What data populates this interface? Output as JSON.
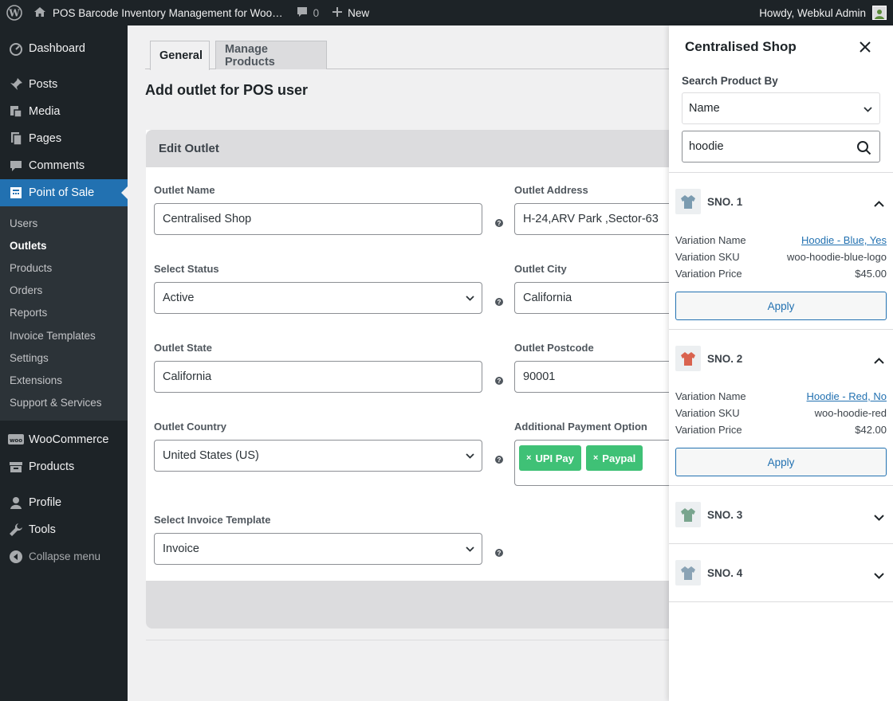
{
  "admin_bar": {
    "site_title": "POS Barcode Inventory Management for Woo…",
    "comment_count": "0",
    "new_label": "New",
    "greeting": "Howdy, Webkul Admin"
  },
  "sidebar": {
    "top_items": [
      {
        "label": "Dashboard"
      }
    ],
    "main_items": [
      {
        "label": "Posts"
      },
      {
        "label": "Media"
      },
      {
        "label": "Pages"
      },
      {
        "label": "Comments"
      },
      {
        "label": "Point of Sale"
      }
    ],
    "submenu": [
      {
        "label": "Users"
      },
      {
        "label": "Outlets"
      },
      {
        "label": "Products"
      },
      {
        "label": "Orders"
      },
      {
        "label": "Reports"
      },
      {
        "label": "Invoice Templates"
      },
      {
        "label": "Settings"
      },
      {
        "label": "Extensions"
      },
      {
        "label": "Support & Services"
      }
    ],
    "woo_items": [
      {
        "label": "WooCommerce"
      },
      {
        "label": "Products"
      }
    ],
    "bottom_items": [
      {
        "label": "Profile"
      },
      {
        "label": "Tools"
      },
      {
        "label": "Collapse menu"
      }
    ]
  },
  "tabs": {
    "general": "General",
    "manage_products": "Manage Products"
  },
  "page_title": "Add outlet for POS user",
  "form": {
    "heading": "Edit Outlet",
    "outlet_name": {
      "label": "Outlet Name",
      "value": "Centralised Shop"
    },
    "outlet_address": {
      "label": "Outlet Address",
      "value": "H-24,ARV Park ,Sector-63"
    },
    "status": {
      "label": "Select Status",
      "value": "Active"
    },
    "city": {
      "label": "Outlet City",
      "value": "California"
    },
    "state": {
      "label": "Outlet State",
      "value": "California"
    },
    "postcode": {
      "label": "Outlet Postcode",
      "value": "90001"
    },
    "country": {
      "label": "Outlet Country",
      "value": "United States (US)"
    },
    "payment": {
      "label": "Additional Payment Option",
      "chips": [
        "UPI Pay",
        "Paypal"
      ]
    },
    "invoice": {
      "label": "Select Invoice Template",
      "value": "Invoice"
    },
    "help_glyph": "?"
  },
  "panel": {
    "title": "Centralised Shop",
    "search_by_label": "Search Product By",
    "search_by_value": "Name",
    "search_value": "hoodie",
    "labels": {
      "name": "Variation Name",
      "sku": "Variation SKU",
      "price": "Variation Price",
      "apply": "Apply"
    },
    "results": [
      {
        "title": "SNO. 1",
        "expanded": true,
        "name": "Hoodie - Blue, Yes",
        "sku": "woo-hoodie-blue-logo",
        "price": "$45.00",
        "thumb_color": "#7b9bb0"
      },
      {
        "title": "SNO. 2",
        "expanded": true,
        "name": "Hoodie - Red, No",
        "sku": "woo-hoodie-red",
        "price": "$42.00",
        "thumb_color": "#d9634f"
      },
      {
        "title": "SNO. 3",
        "expanded": false,
        "thumb_color": "#79a58e"
      },
      {
        "title": "SNO. 4",
        "expanded": false,
        "thumb_color": "#8aa3b5"
      }
    ]
  }
}
